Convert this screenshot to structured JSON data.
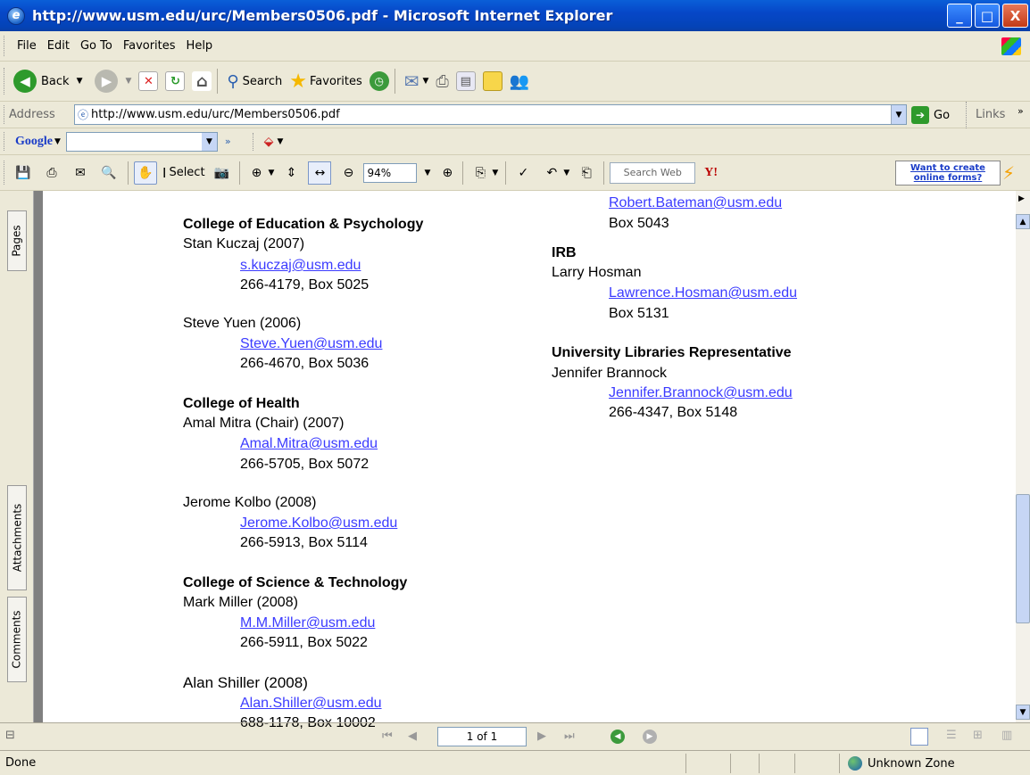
{
  "window": {
    "title": "http://www.usm.edu/urc/Members0506.pdf - Microsoft Internet Explorer",
    "minimize": "_",
    "maximize": "□",
    "close": "X"
  },
  "menu": [
    "File",
    "Edit",
    "Go To",
    "Favorites",
    "Help"
  ],
  "toolbar": {
    "back": "Back",
    "search": "Search",
    "favorites": "Favorites"
  },
  "address": {
    "label": "Address",
    "url": "http://www.usm.edu/urc/Members0506.pdf",
    "go": "Go",
    "links": "Links"
  },
  "google": {
    "label": "Google"
  },
  "pdf": {
    "select": "Select",
    "zoom": "94%",
    "search_placeholder": "Search Web",
    "ad": "Want to create online forms?"
  },
  "nav": {
    "pages": "Pages",
    "attachments": "Attachments",
    "comments": "Comments"
  },
  "doc": {
    "left": [
      {
        "type": "heading",
        "text": "College of Education & Psychology"
      },
      {
        "type": "name",
        "text": "Stan Kuczaj (2007)"
      },
      {
        "type": "email",
        "text": "s.kuczaj@usm.edu"
      },
      {
        "type": "info",
        "text": "266-4179, Box 5025"
      },
      {
        "type": "name",
        "text": "Steve Yuen (2006)"
      },
      {
        "type": "email",
        "text": "Steve.Yuen@usm.edu"
      },
      {
        "type": "info",
        "text": "266-4670, Box 5036"
      },
      {
        "type": "heading",
        "text": "College of Health"
      },
      {
        "type": "name",
        "text": "Amal Mitra (Chair) (2007)"
      },
      {
        "type": "email",
        "text": "Amal.Mitra@usm.edu"
      },
      {
        "type": "info",
        "text": "266-5705, Box 5072"
      },
      {
        "type": "name",
        "text": "Jerome Kolbo (2008)"
      },
      {
        "type": "email",
        "text": "Jerome.Kolbo@usm.edu"
      },
      {
        "type": "info",
        "text": "266-5913, Box 5114"
      },
      {
        "type": "heading",
        "text": "College of Science & Technology"
      },
      {
        "type": "name",
        "text": "Mark Miller (2008)"
      },
      {
        "type": "email",
        "text": "M.M.Miller@usm.edu"
      },
      {
        "type": "info",
        "text": "266-5911, Box 5022"
      },
      {
        "type": "name",
        "text": "Alan Shiller (2008)"
      },
      {
        "type": "email",
        "text": "Alan.Shiller@usm.edu"
      },
      {
        "type": "info",
        "text": "688-1178, Box 10002"
      }
    ],
    "right": [
      {
        "type": "email",
        "text": "Robert.Bateman@usm.edu"
      },
      {
        "type": "info",
        "text": "Box 5043"
      },
      {
        "type": "heading",
        "text": "IRB"
      },
      {
        "type": "name",
        "text": "Larry Hosman"
      },
      {
        "type": "email",
        "text": "Lawrence.Hosman@usm.edu"
      },
      {
        "type": "info",
        "text": "Box 5131"
      },
      {
        "type": "heading",
        "text": "University Libraries Representative"
      },
      {
        "type": "name",
        "text": "Jennifer Brannock"
      },
      {
        "type": "email",
        "text": "Jennifer.Brannock@usm.edu"
      },
      {
        "type": "info",
        "text": "266-4347, Box 5148"
      }
    ]
  },
  "pagenav": {
    "page": "1 of 1"
  },
  "status": {
    "left": "Done",
    "zone": "Unknown Zone"
  },
  "colors": {
    "link": "#3b3bff",
    "titlebar": "#0647c8"
  }
}
